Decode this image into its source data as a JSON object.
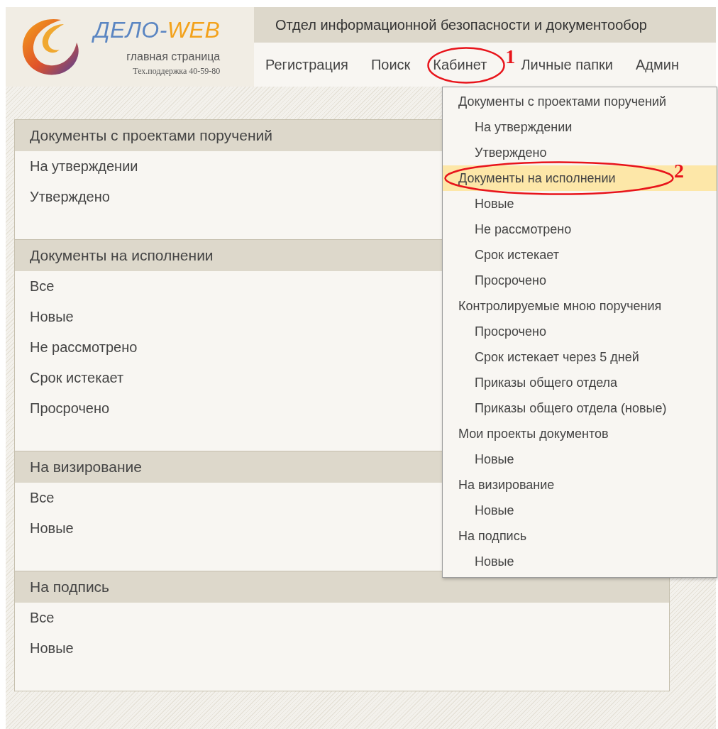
{
  "header": {
    "logo": {
      "name": "ДЕЛО-",
      "suffix": "WEB",
      "subtitle": "главная страница",
      "support": "Тех.поддержка 40-59-80"
    },
    "title": "Отдел информационной безопасности и документообор",
    "nav": [
      {
        "label": "Регистрация"
      },
      {
        "label": "Поиск"
      },
      {
        "label": "Кабинет",
        "annotation": "1"
      },
      {
        "label": "Личные папки"
      },
      {
        "label": "Админ"
      }
    ]
  },
  "sections": [
    {
      "title": "Документы с проектами поручений",
      "items": [
        "На утверждении",
        "Утверждено"
      ]
    },
    {
      "title": "Документы на исполнении",
      "items": [
        "Все",
        "Новые",
        "Не рассмотрено",
        "Срок истекает",
        "Просрочено"
      ]
    },
    {
      "title": "На визирование",
      "items": [
        "Все",
        "Новые"
      ]
    },
    {
      "title": "На подпись",
      "items": [
        "Все",
        "Новые"
      ]
    }
  ],
  "dropdown": [
    {
      "label": "Документы с проектами поручений",
      "selected": false,
      "children": [
        {
          "label": "На утверждении",
          "selected": false
        },
        {
          "label": "Утверждено",
          "selected": false
        }
      ]
    },
    {
      "label": "Документы на исполнении",
      "selected": true,
      "annotation": "2",
      "children": [
        {
          "label": "Новые",
          "selected": false
        },
        {
          "label": "Не рассмотрено",
          "selected": false
        },
        {
          "label": "Срок истекает",
          "selected": false
        },
        {
          "label": "Просрочено",
          "selected": false
        }
      ]
    },
    {
      "label": "Контролируемые мною поручения",
      "selected": false,
      "children": [
        {
          "label": "Просрочено",
          "selected": false
        },
        {
          "label": "Срок истекает через 5 дней",
          "selected": false
        },
        {
          "label": "Приказы общего отдела",
          "selected": false
        },
        {
          "label": "Приказы общего отдела (новые)",
          "selected": false
        }
      ]
    },
    {
      "label": "Мои проекты документов",
      "selected": false,
      "children": [
        {
          "label": "Новые",
          "selected": false
        }
      ]
    },
    {
      "label": "На визирование",
      "selected": false,
      "children": [
        {
          "label": "Новые",
          "selected": false
        }
      ]
    },
    {
      "label": "На подпись",
      "selected": false,
      "children": [
        {
          "label": "Новые",
          "selected": false
        }
      ]
    }
  ]
}
